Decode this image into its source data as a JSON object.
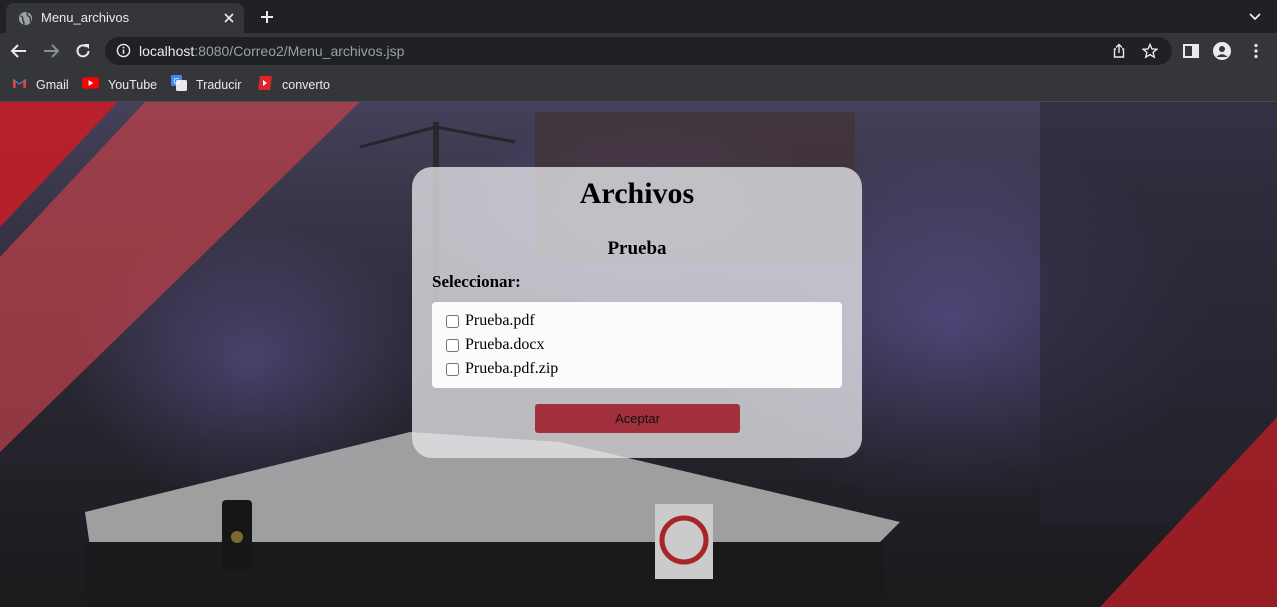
{
  "browser": {
    "tab_title": "Menu_archivos",
    "url_host": "localhost",
    "url_rest": ":8080/Correo2/Menu_archivos.jsp",
    "bookmarks": [
      {
        "label": "Gmail",
        "icon": "gmail-icon"
      },
      {
        "label": "YouTube",
        "icon": "youtube-icon"
      },
      {
        "label": "Traducir",
        "icon": "translate-icon"
      },
      {
        "label": "converto",
        "icon": "converto-icon"
      }
    ]
  },
  "card": {
    "title": "Archivos",
    "subtitle": "Prueba",
    "select_label": "Seleccionar:",
    "files": [
      {
        "name": "Prueba.pdf",
        "checked": false
      },
      {
        "name": "Prueba.docx",
        "checked": false
      },
      {
        "name": "Prueba.pdf.zip",
        "checked": false
      }
    ],
    "accept_label": "Aceptar"
  },
  "colors": {
    "accent_button": "#a2303c",
    "brand_red": "#e0222c"
  }
}
